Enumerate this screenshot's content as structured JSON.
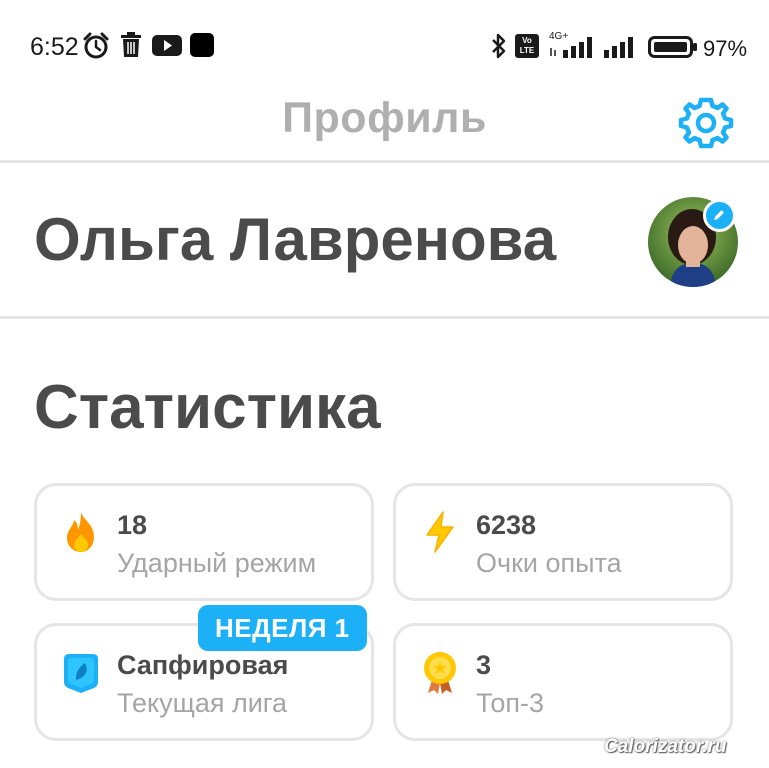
{
  "status_bar": {
    "time": "6:52",
    "icons_left": [
      "alarm-icon",
      "trash-icon",
      "youtube-icon",
      "app-square-icon"
    ],
    "icons_right": [
      "bluetooth-icon",
      "volte-icon",
      "signal-4g-icon",
      "signal-icon",
      "battery-icon"
    ],
    "network_label": "4G+",
    "volte_label": "Vo LTE",
    "battery_percent": "97%"
  },
  "header": {
    "title": "Профиль",
    "settings_icon": "gear-icon"
  },
  "profile": {
    "name": "Ольга Лавренова",
    "edit_icon": "pencil-icon"
  },
  "stats": {
    "title": "Статистика",
    "cards": [
      {
        "value": "18",
        "label": "Ударный режим",
        "icon": "fire-icon"
      },
      {
        "value": "6238",
        "label": "Очки опыта",
        "icon": "lightning-icon"
      },
      {
        "value": "Сапфировая",
        "label": "Текущая лига",
        "icon": "sapphire-league-icon"
      },
      {
        "value": "3",
        "label": "Топ-3",
        "icon": "gold-medal-icon"
      }
    ],
    "week_badge": "НЕДЕЛЯ 1"
  },
  "watermark": "Calorizator.ru",
  "colors": {
    "accent": "#1cb0f6",
    "title_gray": "#afafaf",
    "text_dark": "#4b4b4b",
    "label_gray": "#a5a5a5",
    "border": "#e5e5e5",
    "fire": "#ff9600",
    "lightning": "#ffc800"
  }
}
